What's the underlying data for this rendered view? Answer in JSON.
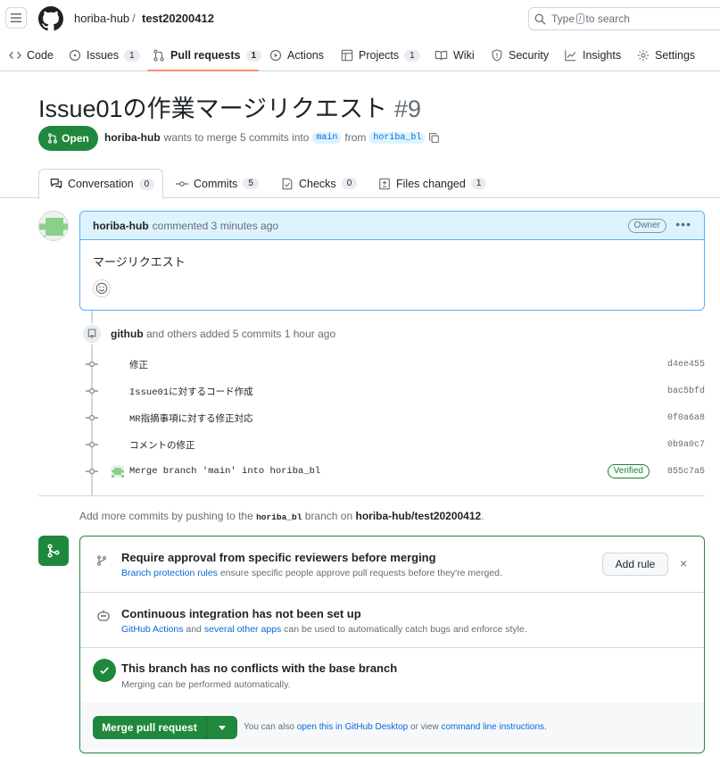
{
  "header": {
    "owner": "horiba-hub",
    "separator": "/",
    "repo": "test20200412",
    "search_before": "Type",
    "search_key": "/",
    "search_after": "to search"
  },
  "nav": [
    {
      "label": "Code",
      "icon": "code-icon"
    },
    {
      "label": "Issues",
      "count": "1",
      "icon": "issue-icon"
    },
    {
      "label": "Pull requests",
      "count": "1",
      "icon": "pull-request-icon",
      "active": true
    },
    {
      "label": "Actions",
      "icon": "play-icon"
    },
    {
      "label": "Projects",
      "count": "1",
      "icon": "table-icon"
    },
    {
      "label": "Wiki",
      "icon": "book-icon"
    },
    {
      "label": "Security",
      "icon": "shield-icon"
    },
    {
      "label": "Insights",
      "icon": "graph-icon"
    },
    {
      "label": "Settings",
      "icon": "gear-icon"
    }
  ],
  "pr": {
    "title": "Issue01の作業マージリクエスト",
    "number": "#9",
    "state": "Open",
    "author": "horiba-hub",
    "meta_text": "wants to merge 5 commits into",
    "base_branch": "main",
    "from_text": "from",
    "head_branch": "horiba_bl"
  },
  "tabs": [
    {
      "label": "Conversation",
      "count": "0"
    },
    {
      "label": "Commits",
      "count": "5"
    },
    {
      "label": "Checks",
      "count": "0"
    },
    {
      "label": "Files changed",
      "count": "1"
    }
  ],
  "comment": {
    "author": "horiba-hub",
    "action": "commented 3 minutes ago",
    "badge": "Owner",
    "body": "マージリクエスト"
  },
  "push_event": {
    "actor": "github",
    "text": "and others added 5 commits 1 hour ago"
  },
  "commits": [
    {
      "message": "修正",
      "sha": "d4ee455"
    },
    {
      "message": "Issue01に対するコード作成",
      "sha": "bac5bfd"
    },
    {
      "message": "MR指摘事項に対する修正対応",
      "sha": "0f0a6a8"
    },
    {
      "message": "コメントの修正",
      "sha": "0b9a0c7"
    },
    {
      "message": "Merge branch 'main' into horiba_bl",
      "sha": "855c7a5",
      "verified": "Verified"
    }
  ],
  "add_more": {
    "prefix": "Add more commits by pushing to the",
    "branch": "horiba_bl",
    "middle": "branch on",
    "repo": "horiba-hub/test20200412",
    "suffix": "."
  },
  "merge_box": {
    "approval_title": "Require approval from specific reviewers before merging",
    "approval_link": "Branch protection rules",
    "approval_desc": "ensure specific people approve pull requests before they're merged.",
    "add_rule": "Add rule",
    "dismiss": "×",
    "ci_title": "Continuous integration has not been set up",
    "ci_link1": "GitHub Actions",
    "ci_and": "and",
    "ci_link2": "several other apps",
    "ci_desc": "can be used to automatically catch bugs and enforce style.",
    "conflict_title": "This branch has no conflicts with the base branch",
    "conflict_desc": "Merging can be performed automatically.",
    "merge_button": "Merge pull request",
    "hint_prefix": "You can also",
    "hint_link1": "open this in GitHub Desktop",
    "hint_mid": "or view",
    "hint_link2": "command line instructions",
    "hint_suffix": "."
  },
  "colors": {
    "accent_green": "#1f883d",
    "link_blue": "#0969da",
    "comment_header_bg": "#ddf4ff",
    "nav_underline": "#fd8c73"
  }
}
